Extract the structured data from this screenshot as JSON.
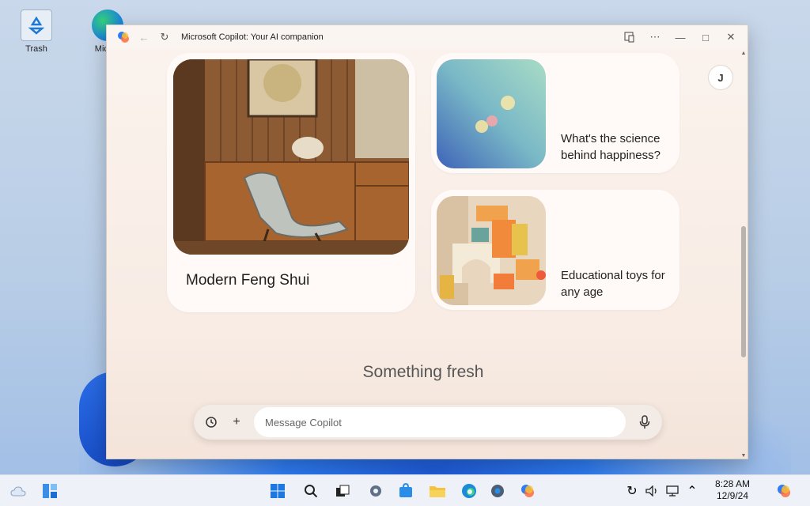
{
  "desktop": {
    "icons": [
      {
        "label": "Trash"
      },
      {
        "label": "Micros"
      }
    ]
  },
  "window": {
    "title": "Microsoft Copilot: Your AI companion",
    "avatar_initial": "J"
  },
  "cards": {
    "big": {
      "title": "Modern Feng Shui"
    },
    "small": [
      {
        "title": "What's the science behind happiness?"
      },
      {
        "title": "Educational toys for any age"
      }
    ]
  },
  "section_heading": "Something fresh",
  "composer": {
    "placeholder": "Message Copilot"
  },
  "taskbar": {
    "time": "8:28 AM",
    "date": "12/9/24"
  },
  "colors": {
    "window_bg": "#fbf3ee",
    "card_bg": "#fffaf7",
    "taskbar_bg": "#eef2f8"
  }
}
